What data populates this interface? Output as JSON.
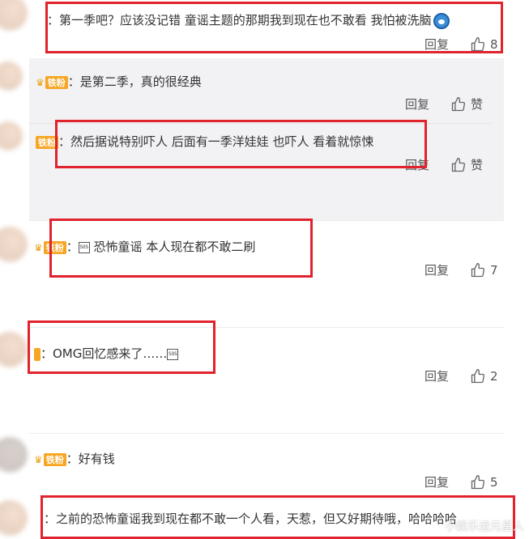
{
  "comments": [
    {
      "badge": "",
      "text": "：第一季吧？应该没记错 童谣主题的那期我到现在也不敢看 我怕被洗脑",
      "reply_label": "回复",
      "like_count": "8"
    },
    {
      "badge": "铁粉",
      "text": "：",
      "emoji_label": "SOS",
      "text_after": " 恐怖童谣 本人现在都不敢二刷",
      "reply_label": "回复",
      "like_count": "7"
    },
    {
      "badge": "",
      "text": "：OMG回忆感来了……",
      "emoji_label": "SOS",
      "reply_label": "回复",
      "like_count": "2"
    },
    {
      "badge": "铁粉",
      "text": "：好有钱",
      "reply_label": "回复",
      "like_count": "5"
    },
    {
      "badge": "",
      "text": "：之前的恐怖童谣我到现在都不敢一个人看，天惹，但又好期待哦，哈哈哈哈"
    }
  ],
  "replies": [
    {
      "badge": "铁粉",
      "text": "：是第二季，真的很经典",
      "reply_label": "回复",
      "like_label": "赞"
    },
    {
      "badge": "铁粉",
      "text": "：然后据说特别吓人 后面有一季洋娃娃 也吓人 看着就惊悚",
      "reply_label": "回复",
      "like_label": "赞"
    }
  ],
  "watermark": "小娱乐运元星人",
  "colors": {
    "highlight": "#e0232c",
    "badge": "#f6a623",
    "subthread_bg": "#f2f2f5"
  },
  "icons": {
    "like": "thumbs-up-icon",
    "emoji": "doraemon-emoji-icon",
    "sos": "sos-emoji-icon"
  }
}
